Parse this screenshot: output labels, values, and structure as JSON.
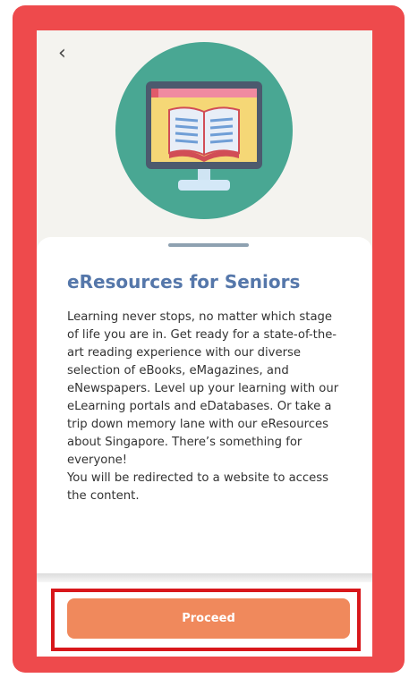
{
  "header": {
    "back_icon": "chevron-left-icon",
    "back_glyph": "‹"
  },
  "hero": {
    "illustration": "computer-monitor-open-book-icon",
    "circle_color": "#49a793"
  },
  "content": {
    "title": "eResources for Seniors",
    "paragraph1": "Learning never stops, no matter which stage of life you are in. Get ready for a state-of-the-art reading experience with our diverse selection of eBooks, eMagazines, and eNewspapers. Level up your learning with our eLearning portals and eDatabases. Or take a trip down memory lane with our eResources about Singapore. There’s something for everyone!",
    "paragraph2": "You will be redirected to a website to access the content."
  },
  "footer": {
    "proceed_label": "Proceed"
  },
  "colors": {
    "frame": "#ee4a4c",
    "accent_button": "#f0895c",
    "title_text": "#5577aa",
    "highlight_box": "#d8171b"
  }
}
